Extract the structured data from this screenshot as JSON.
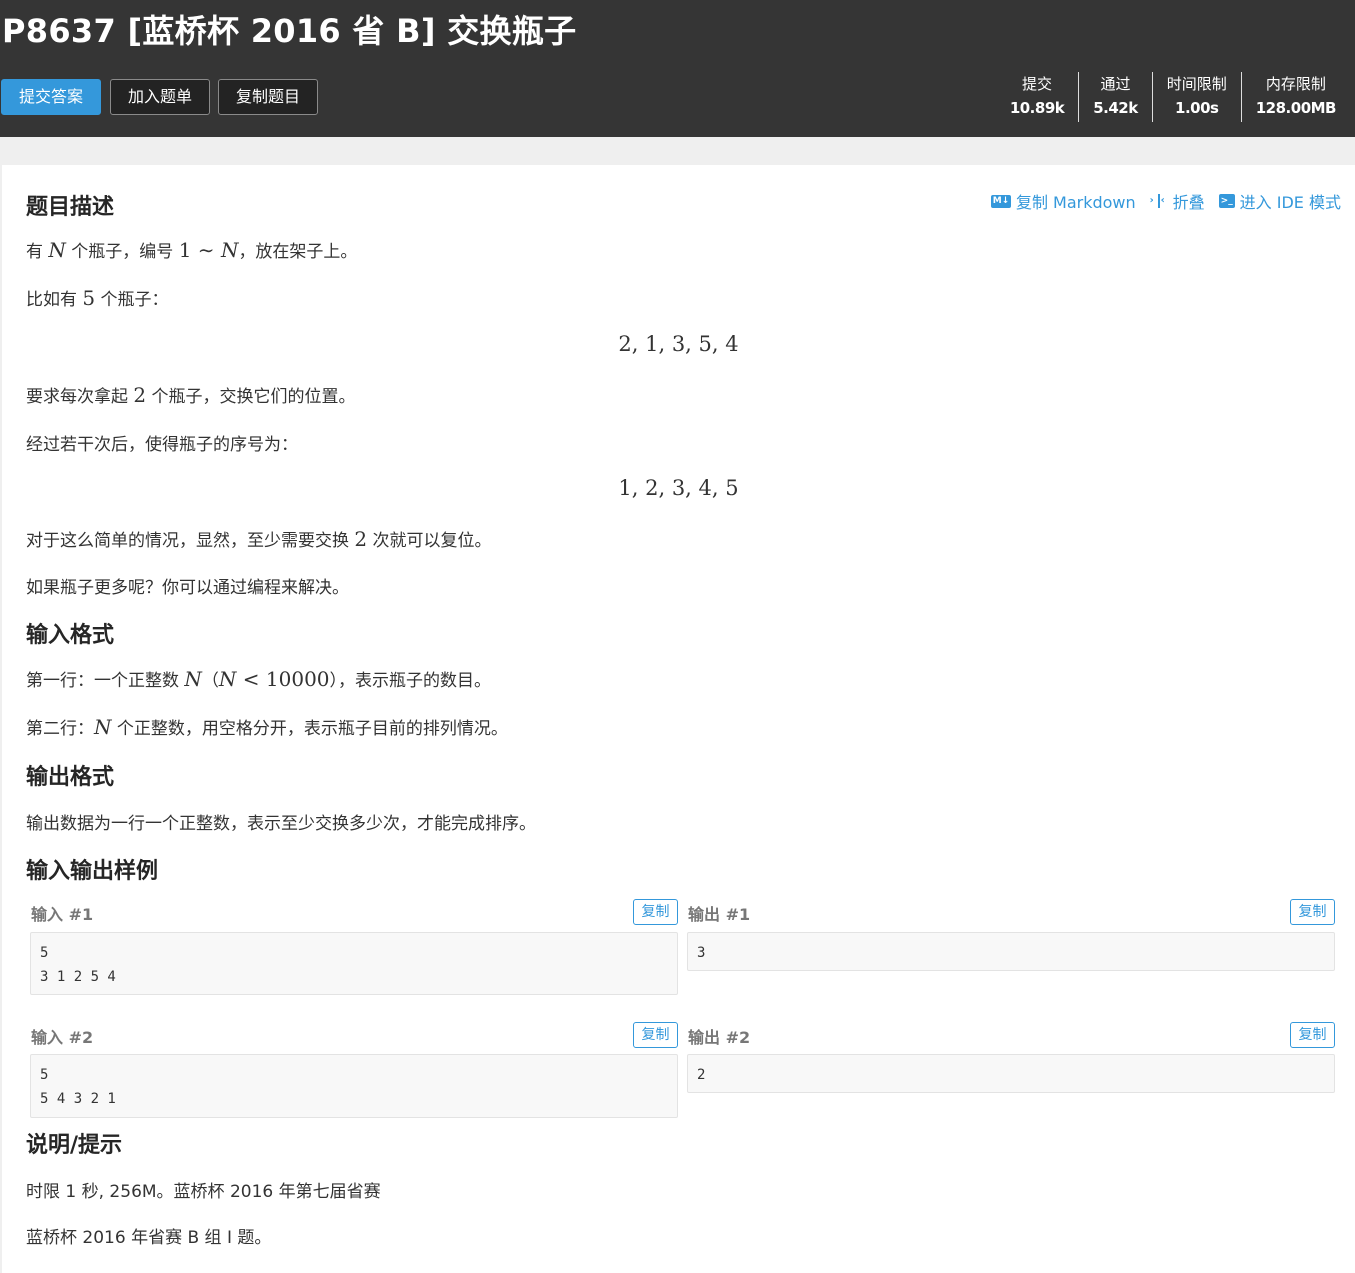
{
  "header": {
    "title": "P8637 [蓝桥杯 2016 省 B] 交换瓶子",
    "buttons": {
      "submit": "提交答案",
      "add_to_list": "加入题单",
      "copy_problem": "复制题目"
    },
    "stats": [
      {
        "label": "提交",
        "value": "10.89k"
      },
      {
        "label": "通过",
        "value": "5.42k"
      },
      {
        "label": "时间限制",
        "value": "1.00s"
      },
      {
        "label": "内存限制",
        "value": "128.00MB"
      }
    ]
  },
  "toolbar": {
    "md_icon_text": "M↓",
    "copy_markdown": "复制 Markdown",
    "fold": "折叠",
    "ide_icon_text": ">_",
    "ide_mode": "进入 IDE 模式"
  },
  "description": {
    "heading": "题目描述",
    "line1": {
      "a": "有 ",
      "n1": "N",
      "b": " 个瓶子，编号 ",
      "one": "1",
      "tilde": " ∼ ",
      "n2": "N",
      "c": "，放在架子上。"
    },
    "line2": {
      "a": "比如有 ",
      "five": "5",
      "b": " 个瓶子："
    },
    "display1": "2, 1, 3, 5, 4",
    "line3": {
      "a": "要求每次拿起 ",
      "two": "2",
      "b": " 个瓶子，交换它们的位置。"
    },
    "line4": "经过若干次后，使得瓶子的序号为：",
    "display2": "1, 2, 3, 4, 5",
    "line5": {
      "a": "对于这么简单的情况，显然，至少需要交换 ",
      "two": "2",
      "b": " 次就可以复位。"
    },
    "line6": "如果瓶子更多呢？你可以通过编程来解决。"
  },
  "input_format": {
    "heading": "输入格式",
    "line1": {
      "a": "第一行：一个正整数 ",
      "n1": "N",
      "b": "（",
      "n2": "N",
      "lt": " < ",
      "num": "10000",
      "c": "），表示瓶子的数目。"
    },
    "line2": {
      "a": "第二行：",
      "n": "N",
      "b": " 个正整数，用空格分开，表示瓶子目前的排列情况。"
    }
  },
  "output_format": {
    "heading": "输出格式",
    "line1": "输出数据为一行一个正整数，表示至少交换多少次，才能完成排序。"
  },
  "samples": {
    "heading": "输入输出样例",
    "copy_label": "复制",
    "items": [
      {
        "input_label": "输入 #1",
        "input": "5\n3 1 2 5 4",
        "output_label": "输出 #1",
        "output": "3"
      },
      {
        "input_label": "输入 #2",
        "input": "5\n5 4 3 2 1",
        "output_label": "输出 #2",
        "output": "2"
      }
    ]
  },
  "hint": {
    "heading": "说明/提示",
    "line1": "时限 1 秒, 256M。蓝桥杯 2016 年第七届省赛",
    "line2": "蓝桥杯 2016 年省赛 B 组 I 题。"
  }
}
